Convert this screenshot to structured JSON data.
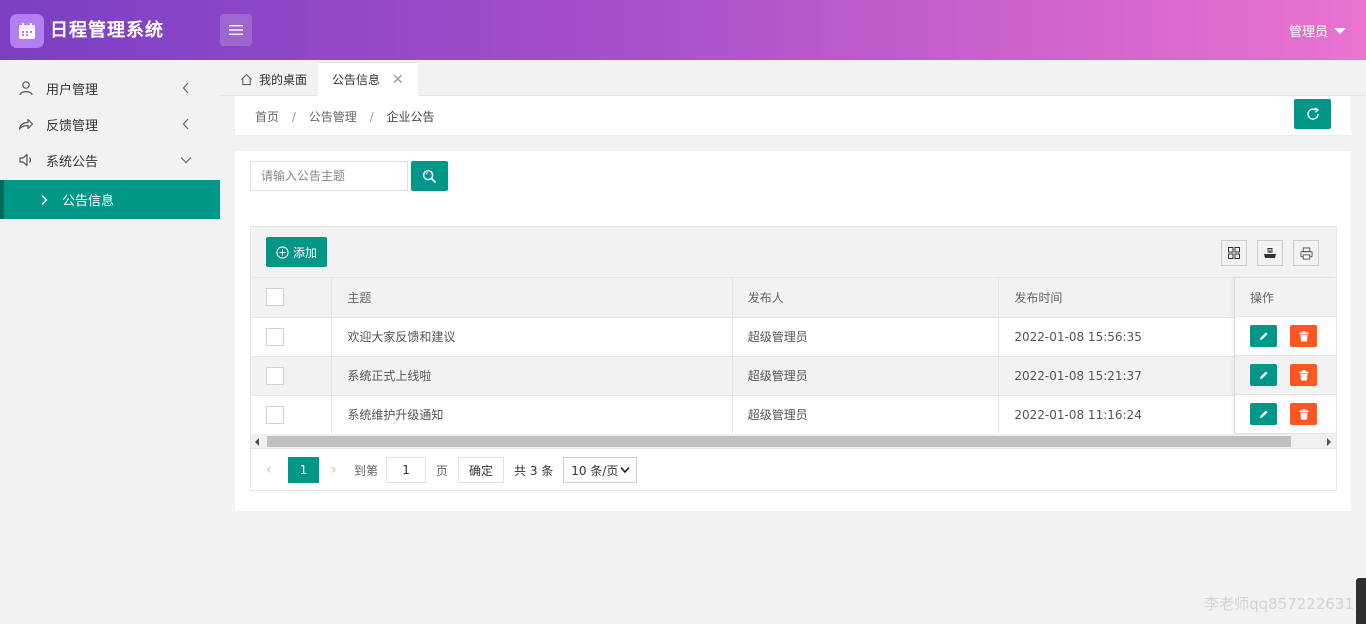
{
  "app": {
    "title": "日程管理系统",
    "user": "管理员"
  },
  "sidebar": {
    "items": [
      {
        "label": "用户管理",
        "icon": "user-icon"
      },
      {
        "label": "反馈管理",
        "icon": "share-icon"
      },
      {
        "label": "系统公告",
        "icon": "speaker-icon"
      }
    ],
    "sub_item": {
      "label": "公告信息"
    }
  },
  "tabs": {
    "home": "我的桌面",
    "active": "公告信息"
  },
  "breadcrumb": {
    "items": [
      "首页",
      "公告管理",
      "企业公告"
    ],
    "separator": "/"
  },
  "search": {
    "placeholder": "请输入公告主题",
    "value": ""
  },
  "toolbar": {
    "add_label": "添加"
  },
  "table": {
    "columns": [
      "主题",
      "发布人",
      "发布时间",
      "操作"
    ],
    "rows": [
      {
        "title": "欢迎大家反馈和建议",
        "publisher": "超级管理员",
        "time": "2022-01-08 15:56:35"
      },
      {
        "title": "系统正式上线啦",
        "publisher": "超级管理员",
        "time": "2022-01-08 15:21:37"
      },
      {
        "title": "系统维护升级通知",
        "publisher": "超级管理员",
        "time": "2022-01-08 11:16:24"
      }
    ]
  },
  "pager": {
    "current": "1",
    "goto_label": "到第",
    "goto_value": "1",
    "page_word": "页",
    "confirm": "确定",
    "total": "共 3 条",
    "page_size": "10 条/页"
  },
  "watermark": "李老师qq857222631",
  "colors": {
    "primary": "#009688",
    "danger": "#ff5722",
    "header_start": "#7b3fc4",
    "header_end": "#ea73cf"
  }
}
